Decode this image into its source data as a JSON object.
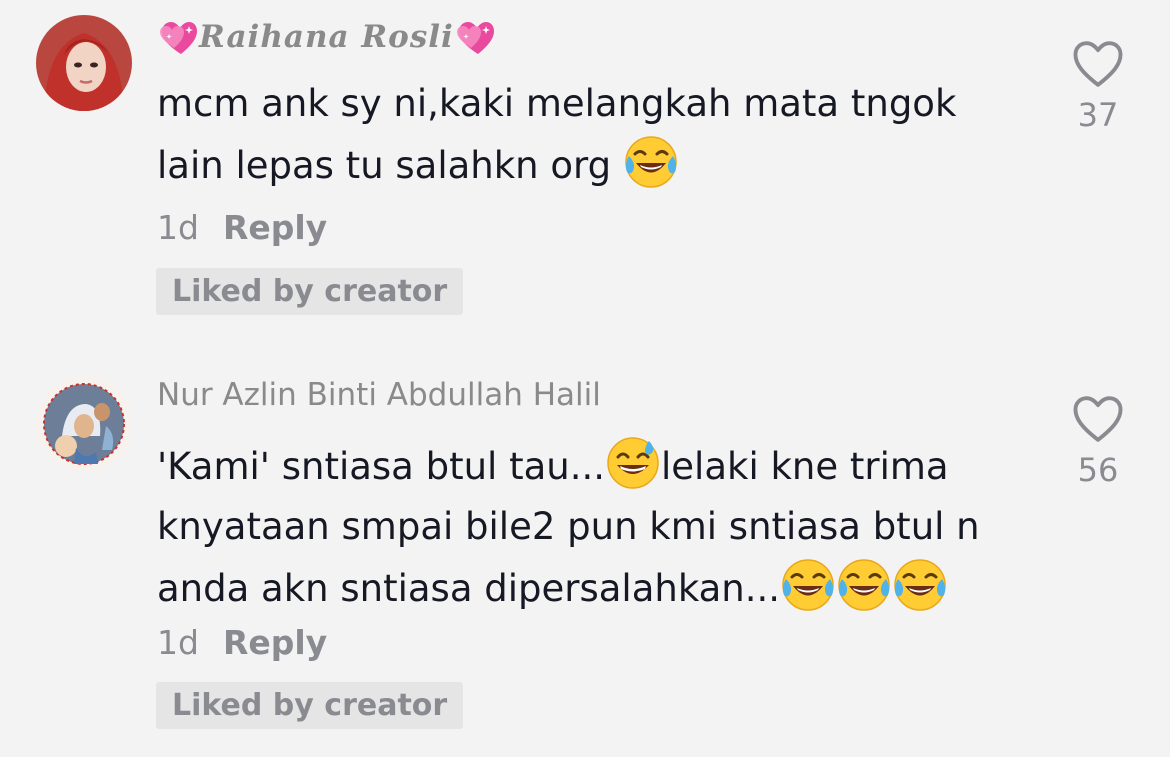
{
  "comments": [
    {
      "username": "Raihana Rosli",
      "text_line1": "mcm ank sy ni,kaki melangkah mata tngok",
      "text_line2": "lain lepas tu salahkn org",
      "time": "1d",
      "reply_label": "Reply",
      "badge": "Liked by creator",
      "likes": "37",
      "emoji": "face-with-tears-of-joy",
      "name_decoration": "sparkling-heart-icon"
    },
    {
      "username": "Nur Azlin Binti Abdullah Halil",
      "text_line1_a": "'Kami' sntiasa btul tau...",
      "text_line1_b": "lelaki kne trima",
      "text_line2": "knyataan smpai bile2 pun kmi sntiasa btul n",
      "text_line3": "anda akn sntiasa dipersalahkan...",
      "time": "1d",
      "reply_label": "Reply",
      "badge": "Liked by creator",
      "likes": "56",
      "emojis": [
        "grinning-face-with-sweat",
        "face-with-tears-of-joy",
        "face-with-tears-of-joy",
        "face-with-tears-of-joy"
      ]
    }
  ],
  "colors": {
    "background": "#f4f3f3",
    "text": "#161823",
    "secondary": "#8a8b91",
    "badge_bg": "#e6e5e5",
    "heart_deco": "#e84aa0"
  }
}
